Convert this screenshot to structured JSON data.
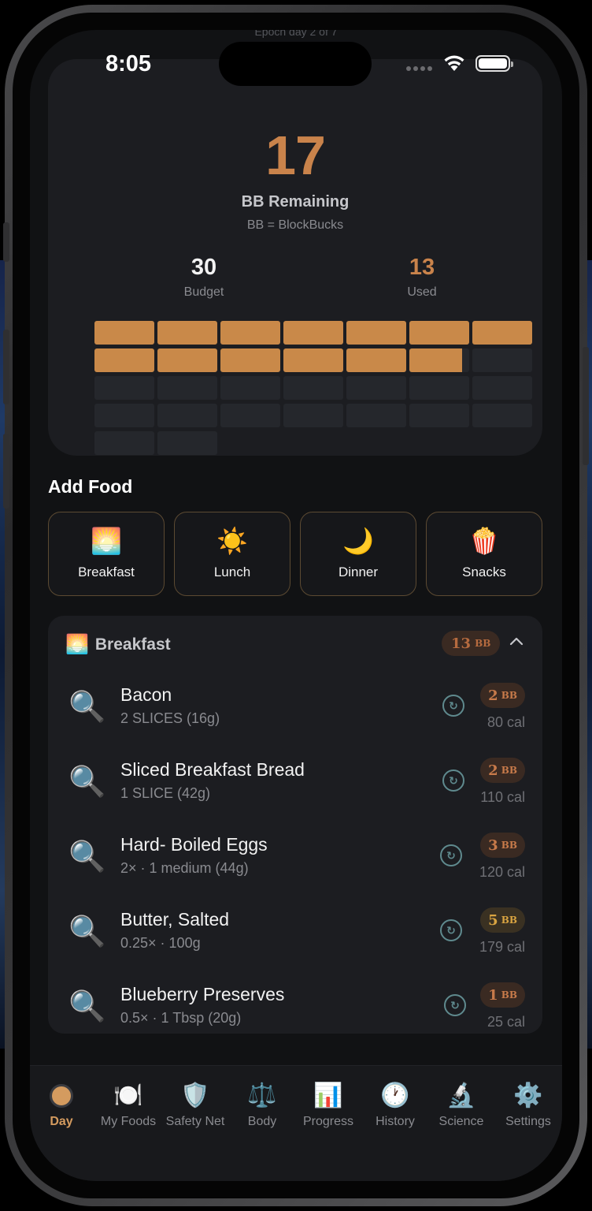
{
  "epoch_label": "Epoch day 2 of 7",
  "status_bar": {
    "time": "8:05"
  },
  "budget": {
    "remaining": "17",
    "remaining_label": "BB Remaining",
    "definition": "BB = BlockBucks",
    "budget_value": "30",
    "budget_label": "Budget",
    "used_value": "13",
    "used_label": "Used",
    "block_grid": {
      "total_blocks": 30,
      "used_blocks": 13,
      "partial_fraction": 0.9
    }
  },
  "add_food": {
    "title": "Add Food",
    "meals": [
      {
        "emoji": "🌅",
        "label": "Breakfast"
      },
      {
        "emoji": "☀️",
        "label": "Lunch"
      },
      {
        "emoji": "🌙",
        "label": "Dinner"
      },
      {
        "emoji": "🍿",
        "label": "Snacks"
      }
    ]
  },
  "breakfast_section": {
    "emoji": "🌅",
    "title": "Breakfast",
    "total_value": "13",
    "total_unit": "BB",
    "items": [
      {
        "name": "Bacon",
        "serving": "2 SLICES (16g)",
        "bb": "2",
        "bb_unit": "BB",
        "cal": "80 cal"
      },
      {
        "name": "Sliced Breakfast Bread",
        "serving": "1 SLICE (42g)",
        "bb": "2",
        "bb_unit": "BB",
        "cal": "110 cal"
      },
      {
        "name": "Hard- Boiled Eggs",
        "serving": "2× · 1 medium (44g)",
        "bb": "3",
        "bb_unit": "BB",
        "cal": "120 cal"
      },
      {
        "name": "Butter, Salted",
        "serving": "0.25× · 100g",
        "bb": "5",
        "bb_unit": "BB",
        "cal": "179 cal"
      },
      {
        "name": "Blueberry Preserves",
        "serving": "0.5× · 1 Tbsp (20g)",
        "bb": "1",
        "bb_unit": "BB",
        "cal": "25 cal"
      }
    ]
  },
  "tabbar": {
    "tabs": [
      {
        "icon": "day-icon",
        "label": "Day"
      },
      {
        "icon": "🍽️",
        "label": "My Foods"
      },
      {
        "icon": "🛡️",
        "label": "Safety Net"
      },
      {
        "icon": "⚖️",
        "label": "Body"
      },
      {
        "icon": "📊",
        "label": "Progress"
      },
      {
        "icon": "🕐",
        "label": "History"
      },
      {
        "icon": "🔬",
        "label": "Science"
      },
      {
        "icon": "⚙️",
        "label": "Settings"
      }
    ],
    "active_tab": "Day"
  },
  "colors": {
    "accent": "#c9834b",
    "block_fill": "#c98949",
    "card_bg": "#1c1d21",
    "screen_bg": "#111214"
  }
}
